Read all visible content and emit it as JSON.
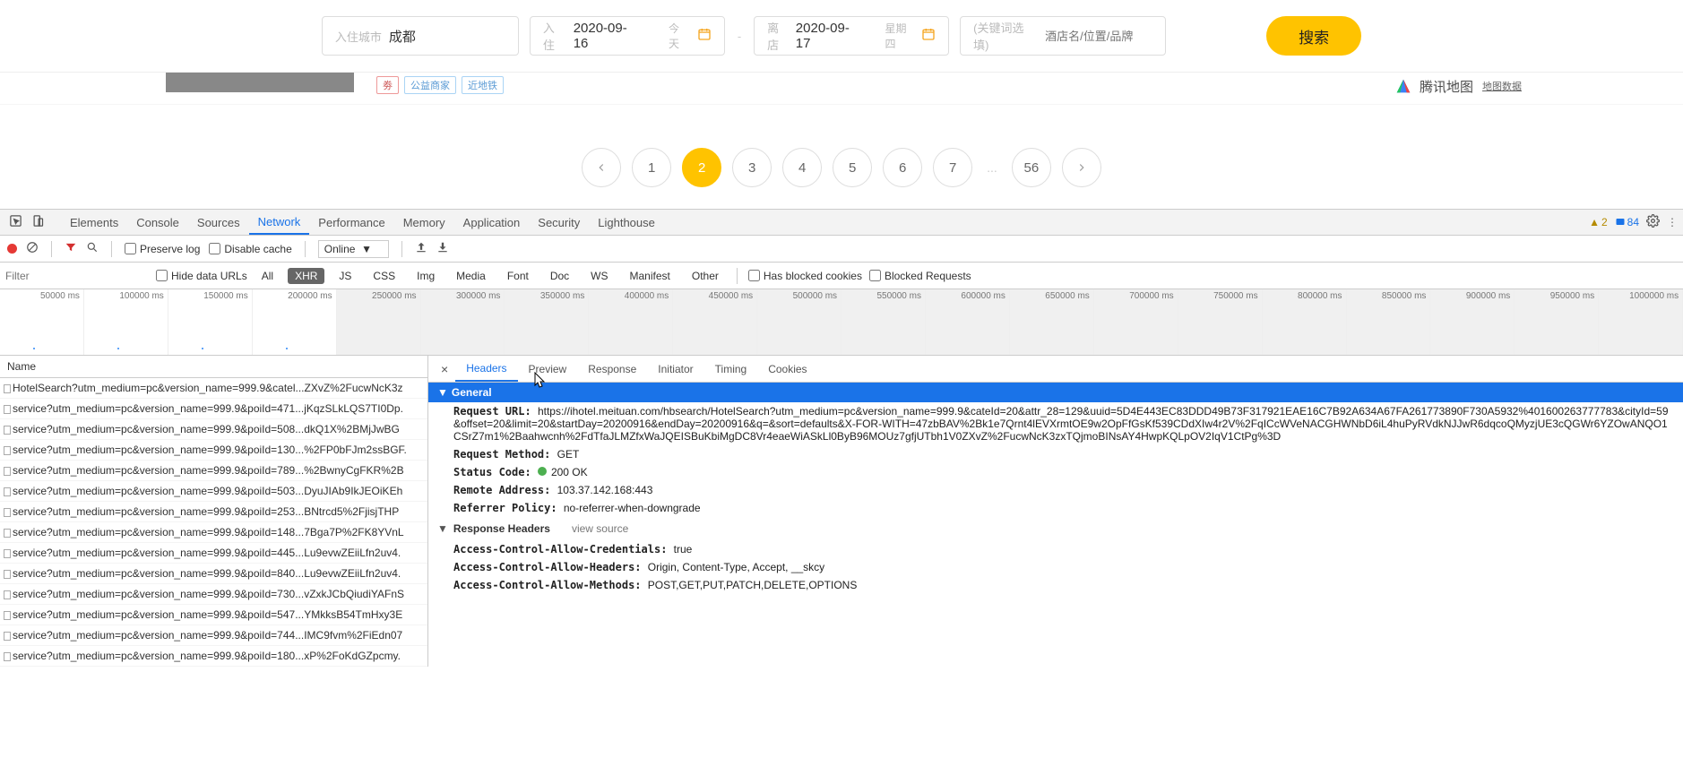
{
  "search": {
    "city_label": "入住城市",
    "city_value": "成都",
    "checkin_label": "入住",
    "checkin_value": "2020-09-16",
    "checkin_extra": "今天",
    "checkout_label": "离店",
    "checkout_value": "2020-09-17",
    "checkout_extra": "星期四",
    "keywords_label": "(关键词选填)",
    "keywords_placeholder": "酒店名/位置/品牌",
    "search_btn": "搜索"
  },
  "tags": {
    "t1": "劵",
    "t2": "公益商家",
    "t3": "近地铁"
  },
  "maps": {
    "brand": "腾讯地图",
    "data": "地图数据"
  },
  "pagination": {
    "pages": [
      "1",
      "2",
      "3",
      "4",
      "5",
      "6",
      "7"
    ],
    "ellipsis": "...",
    "last": "56",
    "active_index": 1
  },
  "devtools": {
    "tabs": [
      "Elements",
      "Console",
      "Sources",
      "Network",
      "Performance",
      "Memory",
      "Application",
      "Security",
      "Lighthouse"
    ],
    "active_tab": 3,
    "warn_count": "2",
    "msg_count": "84",
    "bar2": {
      "preserve": "Preserve log",
      "disable_cache": "Disable cache",
      "online": "Online"
    },
    "bar3": {
      "filter_ph": "Filter",
      "hide_urls": "Hide data URLs",
      "types": [
        "All",
        "XHR",
        "JS",
        "CSS",
        "Img",
        "Media",
        "Font",
        "Doc",
        "WS",
        "Manifest",
        "Other"
      ],
      "active_type": 1,
      "blocked_cookies": "Has blocked cookies",
      "blocked_req": "Blocked Requests"
    },
    "timeline": [
      "50000 ms",
      "100000 ms",
      "150000 ms",
      "200000 ms",
      "250000 ms",
      "300000 ms",
      "350000 ms",
      "400000 ms",
      "450000 ms",
      "500000 ms",
      "550000 ms",
      "600000 ms",
      "650000 ms",
      "700000 ms",
      "750000 ms",
      "800000 ms",
      "850000 ms",
      "900000 ms",
      "950000 ms",
      "1000000 ms"
    ],
    "name_hdr": "Name",
    "requests": [
      "HotelSearch?utm_medium=pc&version_name=999.9&catel...ZXvZ%2FucwNcK3z",
      "service?utm_medium=pc&version_name=999.9&poiId=471...jKqzSLkLQS7TI0Dp.",
      "service?utm_medium=pc&version_name=999.9&poiId=508...dkQ1X%2BMjJwBG",
      "service?utm_medium=pc&version_name=999.9&poiId=130...%2FP0bFJm2ssBGF.",
      "service?utm_medium=pc&version_name=999.9&poiId=789...%2BwnyCgFKR%2B",
      "service?utm_medium=pc&version_name=999.9&poiId=503...DyuJIAb9IkJEOiKEh",
      "service?utm_medium=pc&version_name=999.9&poiId=253...BNtrcd5%2FjisjTHP",
      "service?utm_medium=pc&version_name=999.9&poiId=148...7Bga7P%2FK8YVnL",
      "service?utm_medium=pc&version_name=999.9&poiId=445...Lu9evwZEiiLfn2uv4.",
      "service?utm_medium=pc&version_name=999.9&poiId=840...Lu9evwZEiiLfn2uv4.",
      "service?utm_medium=pc&version_name=999.9&poiId=730...vZxkJCbQiudiYAFnS",
      "service?utm_medium=pc&version_name=999.9&poiId=547...YMkksB54TmHxy3E",
      "service?utm_medium=pc&version_name=999.9&poiId=744...IMC9fvm%2FiEdn07",
      "service?utm_medium=pc&version_name=999.9&poiId=180...xP%2FoKdGZpcmy."
    ],
    "detail_tabs": [
      "Headers",
      "Preview",
      "Response",
      "Initiator",
      "Timing",
      "Cookies"
    ],
    "detail_active": 0,
    "headers": {
      "general_title": "General",
      "url_label": "Request URL:",
      "url_value": "https://ihotel.meituan.com/hbsearch/HotelSearch?utm_medium=pc&version_name=999.9&cateId=20&attr_28=129&uuid=5D4E443EC83DDD49B73F317921EAE16C7B92A634A67FA261773890F730A5932%401600263777783&cityId=59&offset=20&limit=20&startDay=20200916&endDay=20200916&q=&sort=defaults&X-FOR-WITH=47zbBAV%2Bk1e7Qrnt4lEVXrmtOE9w2OpFfGsKf539CDdXIw4r2V%2FqICcWVeNACGHWNbD6iL4huPyRVdkNJJwR6dqcoQMyzjUE3cQGWr6YZOwANQO1CSrZ7m1%2Baahwcnh%2FdTfaJLMZfxWaJQEISBuKbiMgDC8Vr4eaeWiASkLl0ByB96MOUz7gfjUTbh1V0ZXvZ%2FucwNcK3zxTQjmoBINsAY4HwpKQLpOV2IqV1CtPg%3D",
      "method_label": "Request Method:",
      "method_value": "GET",
      "status_label": "Status Code:",
      "status_value": "200 OK",
      "remote_label": "Remote Address:",
      "remote_value": "103.37.142.168:443",
      "referrer_label": "Referrer Policy:",
      "referrer_value": "no-referrer-when-downgrade",
      "resp_title": "Response Headers",
      "view_source": "view source",
      "ac_cred_l": "Access-Control-Allow-Credentials:",
      "ac_cred_v": "true",
      "ac_head_l": "Access-Control-Allow-Headers:",
      "ac_head_v": "Origin, Content-Type, Accept, __skcy",
      "ac_meth_l": "Access-Control-Allow-Methods:",
      "ac_meth_v": "POST,GET,PUT,PATCH,DELETE,OPTIONS"
    }
  }
}
